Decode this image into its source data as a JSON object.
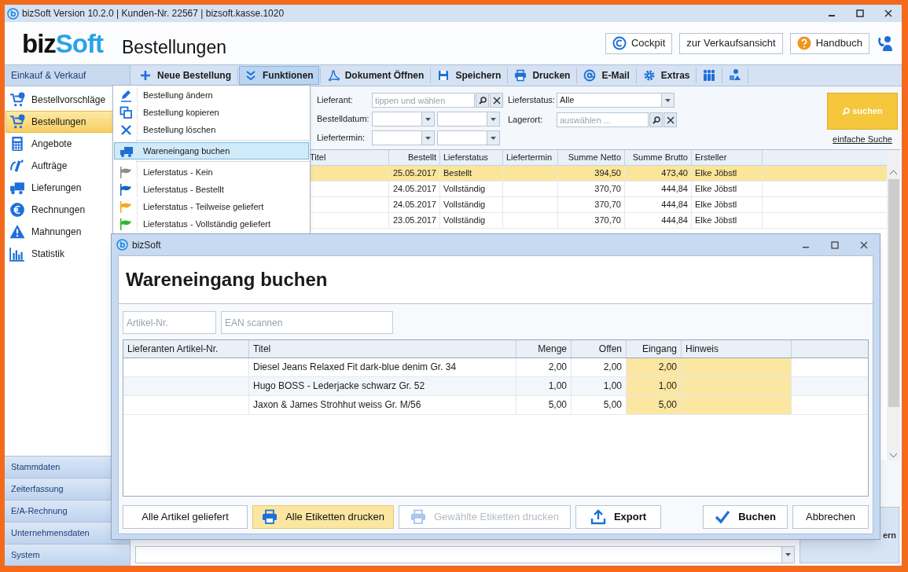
{
  "window": {
    "title": "bizSoft Version 10.2.0 | Kunden-Nr. 22567 | bizsoft.kasse.1020"
  },
  "header": {
    "logo": [
      "biz",
      "Soft"
    ],
    "page_title": "Bestellungen",
    "buttons": [
      "Cockpit",
      "zur Verkaufsansicht",
      "Handbuch"
    ]
  },
  "sidebar": {
    "group": "Einkauf & Verkauf",
    "items": [
      {
        "label": "Bestellvorschläge",
        "selected": false
      },
      {
        "label": "Bestellungen",
        "selected": true
      },
      {
        "label": "Angebote",
        "selected": false
      },
      {
        "label": "Aufträge",
        "selected": false
      },
      {
        "label": "Lieferungen",
        "selected": false
      },
      {
        "label": "Rechnungen",
        "selected": false
      },
      {
        "label": "Mahnungen",
        "selected": false
      },
      {
        "label": "Statistik",
        "selected": false
      }
    ],
    "sections": [
      "Stammdaten",
      "Zeiterfassung",
      "E/A-Rechnung",
      "Unternehmensdaten",
      "System"
    ]
  },
  "toolbar": [
    {
      "label": "Neue Bestellung",
      "selected": false
    },
    {
      "label": "Funktionen",
      "selected": true
    },
    {
      "label": "Dokument Öffnen",
      "selected": false
    },
    {
      "label": "Speichern",
      "selected": false
    },
    {
      "label": "Drucken",
      "selected": false
    },
    {
      "label": "E-Mail",
      "selected": false
    },
    {
      "label": "Extras",
      "selected": false
    }
  ],
  "functions_menu": {
    "groups": [
      {
        "items": [
          {
            "kind": "edit",
            "label": "Bestellung ändern",
            "selected": false
          },
          {
            "kind": "copy",
            "label": "Bestellung kopieren",
            "selected": false
          },
          {
            "kind": "delete",
            "label": "Bestellung löschen",
            "selected": false
          }
        ]
      },
      {
        "items": [
          {
            "kind": "receive",
            "label": "Wareneingang buchen",
            "selected": true
          }
        ]
      },
      {
        "items": [
          {
            "kind": "status",
            "label": "Lieferstatus - Kein",
            "selected": false,
            "color": "#8c8c8c"
          },
          {
            "kind": "status",
            "label": "Lieferstatus - Bestellt",
            "selected": false,
            "color": "#1565c0"
          },
          {
            "kind": "status",
            "label": "Lieferstatus - Teilweise geliefert",
            "selected": false,
            "color": "#f5a623"
          },
          {
            "kind": "status",
            "label": "Lieferstatus - Vollständig geliefert",
            "selected": false,
            "color": "#2fb82f"
          }
        ]
      }
    ]
  },
  "filters": {
    "lieferant": {
      "label": "Lieferant:",
      "placeholder": "tippen und wählen"
    },
    "bestelldatum": {
      "label": "Bestelldatum:"
    },
    "liefertermin": {
      "label": "Liefertermin:"
    },
    "lieferstatus": {
      "label": "Lieferstatus:",
      "value": "Alle"
    },
    "lagerort": {
      "label": "Lagerort:",
      "placeholder": "auswählen ..."
    },
    "search_button": "suchen",
    "simple_search_link": "einfache Suche"
  },
  "orders_table": {
    "columns": [
      "Titel",
      "Bestellt",
      "Lieferstatus",
      "Liefertermin",
      "Summe Netto",
      "Summe Brutto",
      "Ersteller"
    ],
    "rows": [
      {
        "bestellt": "25.05.2017",
        "lieferstatus": "Bestellt",
        "netto": "394,50",
        "brutto": "473,40",
        "ersteller": "Elke Jöbstl",
        "selected": true
      },
      {
        "bestellt": "24.05.2017",
        "lieferstatus": "Vollständig",
        "netto": "370,70",
        "brutto": "444,84",
        "ersteller": "Elke Jöbstl",
        "selected": false
      },
      {
        "bestellt": "24.05.2017",
        "lieferstatus": "Vollständig",
        "netto": "370,70",
        "brutto": "444,84",
        "ersteller": "Elke Jöbstl",
        "selected": false
      },
      {
        "bestellt": "23.05.2017",
        "lieferstatus": "Vollständig",
        "netto": "370,70",
        "brutto": "444,84",
        "ersteller": "Elke Jöbstl",
        "selected": false
      }
    ]
  },
  "covered_button": {
    "label": "ern"
  },
  "dialog": {
    "title": "bizSoft",
    "heading": "Wareneingang buchen",
    "fields": [
      {
        "placeholder": "Artikel-Nr."
      },
      {
        "placeholder": "EAN scannen"
      }
    ],
    "table": {
      "columns": [
        "Lieferanten Artikel-Nr.",
        "Titel",
        "Menge",
        "Offen",
        "Eingang",
        "Hinweis"
      ],
      "rows": [
        {
          "titel": "Diesel Jeans Relaxed Fit dark-blue denim Gr. 34",
          "menge": "2,00",
          "offen": "2,00",
          "eingang": "2,00"
        },
        {
          "titel": "Hugo BOSS - Lederjacke schwarz Gr. 52",
          "menge": "1,00",
          "offen": "1,00",
          "eingang": "1,00"
        },
        {
          "titel": "Jaxon & James Strohhut weiss Gr. M/56",
          "menge": "5,00",
          "offen": "5,00",
          "eingang": "5,00"
        }
      ]
    },
    "buttons": [
      {
        "kind": "plain",
        "label": "Alle Artikel geliefert",
        "highlighted": false,
        "disabled": false
      },
      {
        "kind": "print",
        "label": "Alle Etiketten drucken",
        "highlighted": true,
        "disabled": false
      },
      {
        "kind": "print",
        "label": "Gewählte Etiketten drucken",
        "highlighted": false,
        "disabled": true
      },
      {
        "kind": "export",
        "label": "Export",
        "highlighted": false,
        "disabled": false
      },
      {
        "kind": "confirm",
        "label": "Buchen",
        "highlighted": false,
        "disabled": false
      },
      {
        "kind": "plain",
        "label": "Abbrechen",
        "highlighted": false,
        "disabled": false
      }
    ]
  }
}
